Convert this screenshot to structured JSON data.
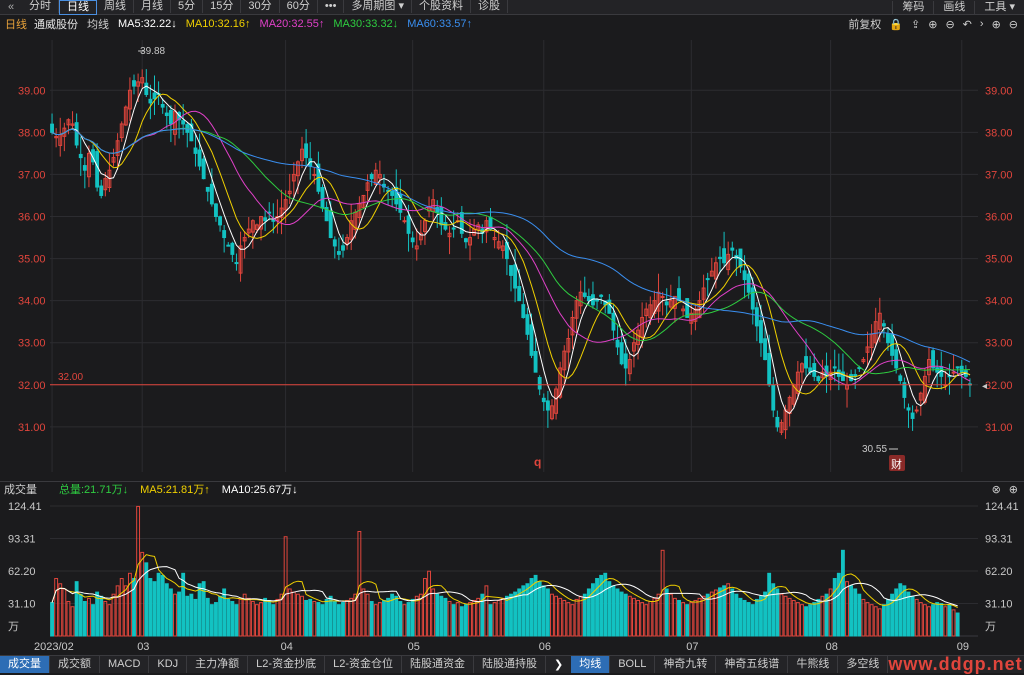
{
  "toolbar": {
    "back_icon": "double-chevron-left-icon",
    "tabs": [
      {
        "label": "分时",
        "active": false
      },
      {
        "label": "日线",
        "active": true
      },
      {
        "label": "周线",
        "active": false
      },
      {
        "label": "月线",
        "active": false
      },
      {
        "label": "5分",
        "active": false
      },
      {
        "label": "15分",
        "active": false
      },
      {
        "label": "30分",
        "active": false
      },
      {
        "label": "60分",
        "active": false
      },
      {
        "label": "•••",
        "active": false
      },
      {
        "label": "多周期图 ▾",
        "active": false
      },
      {
        "label": "个股资料",
        "active": false
      },
      {
        "label": "诊股",
        "active": false
      }
    ],
    "right_tabs": [
      "筹码",
      "画线",
      "工具 ▾"
    ]
  },
  "info": {
    "period": "日线",
    "stock_name": "通威股份",
    "ma_label": "均线",
    "ma": [
      {
        "label": "MA5:32.22↓",
        "color": "#ffffff"
      },
      {
        "label": "MA10:32.16↑",
        "color": "#f0d000"
      },
      {
        "label": "MA20:32.55↑",
        "color": "#e040c8"
      },
      {
        "label": "MA30:33.32↓",
        "color": "#2ecc40"
      },
      {
        "label": "MA60:33.57↑",
        "color": "#3a8ff0"
      }
    ],
    "restore_label": "前复权",
    "icons": [
      "lock-icon",
      "upload-icon",
      "plus-circle-icon",
      "minus-circle-icon",
      "undo-icon",
      "chevron-right-icon",
      "plus-circle-icon",
      "minus-circle-icon"
    ]
  },
  "volume_info": {
    "title": "成交量",
    "total": "总量:21.71万↓",
    "ma5": "MA5:21.81万↑",
    "ma10": "MA10:25.67万↓",
    "icons": [
      "close-circle-icon",
      "plus-circle-icon"
    ]
  },
  "bottom_tabs": [
    {
      "label": "成交量",
      "active": true
    },
    {
      "label": "成交额",
      "active": false
    },
    {
      "label": "MACD",
      "active": false
    },
    {
      "label": "KDJ",
      "active": false
    },
    {
      "label": "主力净额",
      "active": false
    },
    {
      "label": "L2-资金抄底",
      "active": false
    },
    {
      "label": "L2-资金仓位",
      "active": false
    },
    {
      "label": "陆股通资金",
      "active": false
    },
    {
      "label": "陆股通持股",
      "active": false
    },
    {
      "label": "均线",
      "active": true
    },
    {
      "label": "BOLL",
      "active": false
    },
    {
      "label": "神奇九转",
      "active": false
    },
    {
      "label": "神奇五线谱",
      "active": false
    },
    {
      "label": "牛熊线",
      "active": false
    },
    {
      "label": "多空线",
      "active": false
    }
  ],
  "bottom_arrow": "❯",
  "watermark": "www.ddgp.net",
  "chart_data": [
    {
      "type": "candlestick",
      "name": "price",
      "ylim": [
        30.45,
        40.1
      ],
      "yticks": [
        "39.00",
        "38.00",
        "37.00",
        "36.00",
        "35.00",
        "34.00",
        "33.00",
        "32.00",
        "31.00"
      ],
      "ytick_values": [
        39,
        38,
        37,
        36,
        35,
        34,
        33,
        32,
        31
      ],
      "xticks": [
        "2023/02",
        "03",
        "04",
        "05",
        "06",
        "07",
        "08",
        "09"
      ],
      "xtick_index": [
        0,
        22,
        57,
        88,
        120,
        156,
        190,
        222
      ],
      "annotations": {
        "high_label": "39.88",
        "low_label": "30.55",
        "ref_line_label": "32.00",
        "ref_line_value": 32.0,
        "right_price": "32.00",
        "q_marker": "q",
        "fin_marker": "财"
      },
      "closes": [
        38.0,
        37.9,
        37.95,
        38.1,
        38.3,
        38.2,
        37.7,
        37.4,
        37.1,
        37.5,
        37.3,
        36.7,
        36.5,
        36.9,
        37.1,
        37.4,
        37.8,
        38.2,
        38.6,
        39.0,
        39.1,
        39.2,
        39.3,
        38.9,
        38.7,
        38.8,
        38.9,
        38.6,
        38.4,
        38.2,
        38.5,
        38.3,
        38.2,
        38.0,
        37.8,
        37.5,
        37.2,
        36.9,
        36.6,
        36.3,
        36.0,
        35.8,
        35.5,
        35.3,
        35.1,
        34.9,
        35.3,
        35.5,
        35.7,
        35.9,
        35.8,
        36.0,
        35.9,
        36.1,
        35.9,
        36.0,
        36.2,
        36.4,
        36.6,
        37.0,
        37.3,
        37.6,
        37.4,
        37.2,
        37.0,
        36.6,
        36.2,
        35.9,
        35.5,
        35.3,
        35.1,
        35.2,
        35.5,
        35.9,
        36.1,
        36.3,
        36.5,
        36.8,
        36.9,
        37.1,
        37.0,
        36.7,
        36.6,
        36.5,
        36.3,
        36.1,
        35.9,
        35.6,
        35.4,
        35.3,
        35.6,
        35.9,
        36.2,
        36.4,
        36.1,
        35.8,
        35.7,
        35.6,
        35.7,
        35.9,
        35.6,
        35.4,
        35.5,
        35.7,
        35.8,
        35.6,
        35.9,
        35.7,
        35.5,
        35.4,
        35.3,
        35.0,
        34.6,
        34.3,
        34.0,
        33.6,
        33.2,
        32.7,
        32.3,
        31.9,
        31.6,
        31.4,
        31.5,
        31.9,
        32.4,
        32.8,
        33.1,
        33.6,
        34.0,
        34.2,
        34.1,
        34.0,
        33.9,
        34.0,
        34.1,
        33.9,
        33.7,
        33.3,
        32.9,
        32.5,
        32.4,
        32.6,
        33.0,
        33.3,
        33.6,
        33.8,
        33.9,
        34.0,
        34.2,
        34.1,
        33.9,
        34.0,
        34.1,
        34.0,
        33.8,
        33.6,
        33.7,
        33.8,
        34.0,
        34.3,
        34.5,
        34.7,
        34.9,
        35.0,
        34.9,
        35.1,
        35.2,
        35.0,
        34.8,
        34.5,
        34.2,
        33.8,
        33.4,
        33.0,
        32.6,
        32.0,
        31.4,
        31.0,
        31.1,
        31.4,
        31.7,
        32.0,
        32.3,
        32.5,
        32.4,
        32.3,
        32.2,
        32.1,
        32.3,
        32.2,
        32.3,
        32.4,
        32.2,
        32.1,
        32.0,
        32.1,
        32.2,
        32.4,
        32.6,
        32.9,
        33.2,
        33.5,
        33.7,
        33.4,
        33.0,
        32.7,
        32.4,
        32.1,
        31.7,
        31.4,
        31.2,
        31.4,
        31.8,
        32.2,
        32.6,
        32.4,
        32.3,
        32.2,
        32.0,
        32.2,
        32.3,
        32.4,
        32.3,
        32.2,
        32.0
      ]
    },
    {
      "type": "bar",
      "name": "volume",
      "unit": "万",
      "ylim": [
        0,
        124.41
      ],
      "yticks": [
        "124.41",
        "93.31",
        "62.20",
        "31.10",
        "万"
      ],
      "ytick_values": [
        124.41,
        93.31,
        62.2,
        31.1,
        0
      ],
      "values": [
        32,
        55,
        50,
        45,
        33,
        28,
        52,
        40,
        33,
        36,
        30,
        42,
        38,
        33,
        30,
        40,
        48,
        55,
        48,
        60,
        55,
        124,
        80,
        70,
        55,
        52,
        60,
        58,
        50,
        45,
        40,
        42,
        60,
        38,
        40,
        35,
        50,
        52,
        36,
        30,
        32,
        38,
        45,
        35,
        33,
        30,
        35,
        40,
        36,
        33,
        30,
        32,
        36,
        34,
        30,
        35,
        40,
        95,
        45,
        42,
        40,
        38,
        34,
        35,
        33,
        32,
        30,
        35,
        38,
        33,
        30,
        32,
        34,
        36,
        40,
        100,
        45,
        40,
        33,
        30,
        32,
        34,
        36,
        40,
        38,
        33,
        30,
        32,
        35,
        38,
        40,
        55,
        62,
        45,
        40,
        38,
        36,
        33,
        30,
        32,
        28,
        30,
        32,
        34,
        36,
        40,
        48,
        30,
        32,
        34,
        36,
        38,
        40,
        42,
        45,
        48,
        50,
        55,
        58,
        52,
        48,
        45,
        40,
        38,
        36,
        34,
        32,
        30,
        35,
        38,
        40,
        45,
        50,
        55,
        58,
        60,
        52,
        48,
        45,
        42,
        40,
        38,
        36,
        34,
        32,
        30,
        33,
        36,
        40,
        82,
        45,
        40,
        36,
        34,
        32,
        30,
        32,
        34,
        36,
        38,
        40,
        42,
        44,
        46,
        48,
        50,
        45,
        40,
        36,
        34,
        32,
        30,
        35,
        38,
        42,
        60,
        50,
        45,
        40,
        38,
        36,
        34,
        32,
        30,
        28,
        30,
        32,
        35,
        38,
        40,
        45,
        55,
        60,
        82,
        52,
        48,
        45,
        40,
        35,
        32,
        30,
        28,
        26,
        30,
        35,
        40,
        45,
        50,
        48,
        42,
        38,
        35,
        32,
        30,
        28,
        30,
        32,
        31,
        28,
        30,
        25,
        22
      ]
    }
  ]
}
